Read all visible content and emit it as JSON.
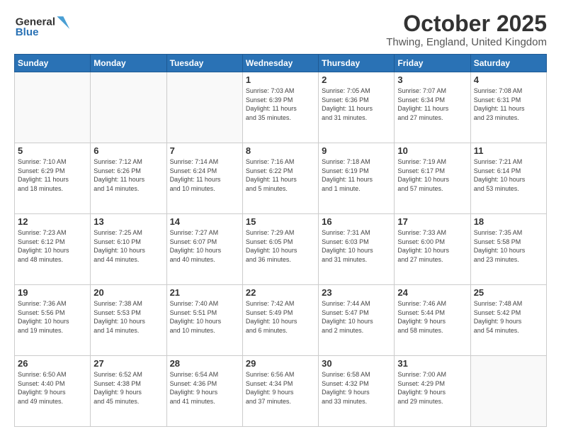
{
  "header": {
    "logo_line1": "General",
    "logo_line2": "Blue",
    "month_title": "October 2025",
    "location": "Thwing, England, United Kingdom"
  },
  "days_of_week": [
    "Sunday",
    "Monday",
    "Tuesday",
    "Wednesday",
    "Thursday",
    "Friday",
    "Saturday"
  ],
  "weeks": [
    [
      {
        "day": "",
        "info": ""
      },
      {
        "day": "",
        "info": ""
      },
      {
        "day": "",
        "info": ""
      },
      {
        "day": "1",
        "info": "Sunrise: 7:03 AM\nSunset: 6:39 PM\nDaylight: 11 hours\nand 35 minutes."
      },
      {
        "day": "2",
        "info": "Sunrise: 7:05 AM\nSunset: 6:36 PM\nDaylight: 11 hours\nand 31 minutes."
      },
      {
        "day": "3",
        "info": "Sunrise: 7:07 AM\nSunset: 6:34 PM\nDaylight: 11 hours\nand 27 minutes."
      },
      {
        "day": "4",
        "info": "Sunrise: 7:08 AM\nSunset: 6:31 PM\nDaylight: 11 hours\nand 23 minutes."
      }
    ],
    [
      {
        "day": "5",
        "info": "Sunrise: 7:10 AM\nSunset: 6:29 PM\nDaylight: 11 hours\nand 18 minutes."
      },
      {
        "day": "6",
        "info": "Sunrise: 7:12 AM\nSunset: 6:26 PM\nDaylight: 11 hours\nand 14 minutes."
      },
      {
        "day": "7",
        "info": "Sunrise: 7:14 AM\nSunset: 6:24 PM\nDaylight: 11 hours\nand 10 minutes."
      },
      {
        "day": "8",
        "info": "Sunrise: 7:16 AM\nSunset: 6:22 PM\nDaylight: 11 hours\nand 5 minutes."
      },
      {
        "day": "9",
        "info": "Sunrise: 7:18 AM\nSunset: 6:19 PM\nDaylight: 11 hours\nand 1 minute."
      },
      {
        "day": "10",
        "info": "Sunrise: 7:19 AM\nSunset: 6:17 PM\nDaylight: 10 hours\nand 57 minutes."
      },
      {
        "day": "11",
        "info": "Sunrise: 7:21 AM\nSunset: 6:14 PM\nDaylight: 10 hours\nand 53 minutes."
      }
    ],
    [
      {
        "day": "12",
        "info": "Sunrise: 7:23 AM\nSunset: 6:12 PM\nDaylight: 10 hours\nand 48 minutes."
      },
      {
        "day": "13",
        "info": "Sunrise: 7:25 AM\nSunset: 6:10 PM\nDaylight: 10 hours\nand 44 minutes."
      },
      {
        "day": "14",
        "info": "Sunrise: 7:27 AM\nSunset: 6:07 PM\nDaylight: 10 hours\nand 40 minutes."
      },
      {
        "day": "15",
        "info": "Sunrise: 7:29 AM\nSunset: 6:05 PM\nDaylight: 10 hours\nand 36 minutes."
      },
      {
        "day": "16",
        "info": "Sunrise: 7:31 AM\nSunset: 6:03 PM\nDaylight: 10 hours\nand 31 minutes."
      },
      {
        "day": "17",
        "info": "Sunrise: 7:33 AM\nSunset: 6:00 PM\nDaylight: 10 hours\nand 27 minutes."
      },
      {
        "day": "18",
        "info": "Sunrise: 7:35 AM\nSunset: 5:58 PM\nDaylight: 10 hours\nand 23 minutes."
      }
    ],
    [
      {
        "day": "19",
        "info": "Sunrise: 7:36 AM\nSunset: 5:56 PM\nDaylight: 10 hours\nand 19 minutes."
      },
      {
        "day": "20",
        "info": "Sunrise: 7:38 AM\nSunset: 5:53 PM\nDaylight: 10 hours\nand 14 minutes."
      },
      {
        "day": "21",
        "info": "Sunrise: 7:40 AM\nSunset: 5:51 PM\nDaylight: 10 hours\nand 10 minutes."
      },
      {
        "day": "22",
        "info": "Sunrise: 7:42 AM\nSunset: 5:49 PM\nDaylight: 10 hours\nand 6 minutes."
      },
      {
        "day": "23",
        "info": "Sunrise: 7:44 AM\nSunset: 5:47 PM\nDaylight: 10 hours\nand 2 minutes."
      },
      {
        "day": "24",
        "info": "Sunrise: 7:46 AM\nSunset: 5:44 PM\nDaylight: 9 hours\nand 58 minutes."
      },
      {
        "day": "25",
        "info": "Sunrise: 7:48 AM\nSunset: 5:42 PM\nDaylight: 9 hours\nand 54 minutes."
      }
    ],
    [
      {
        "day": "26",
        "info": "Sunrise: 6:50 AM\nSunset: 4:40 PM\nDaylight: 9 hours\nand 49 minutes."
      },
      {
        "day": "27",
        "info": "Sunrise: 6:52 AM\nSunset: 4:38 PM\nDaylight: 9 hours\nand 45 minutes."
      },
      {
        "day": "28",
        "info": "Sunrise: 6:54 AM\nSunset: 4:36 PM\nDaylight: 9 hours\nand 41 minutes."
      },
      {
        "day": "29",
        "info": "Sunrise: 6:56 AM\nSunset: 4:34 PM\nDaylight: 9 hours\nand 37 minutes."
      },
      {
        "day": "30",
        "info": "Sunrise: 6:58 AM\nSunset: 4:32 PM\nDaylight: 9 hours\nand 33 minutes."
      },
      {
        "day": "31",
        "info": "Sunrise: 7:00 AM\nSunset: 4:29 PM\nDaylight: 9 hours\nand 29 minutes."
      },
      {
        "day": "",
        "info": ""
      }
    ]
  ]
}
